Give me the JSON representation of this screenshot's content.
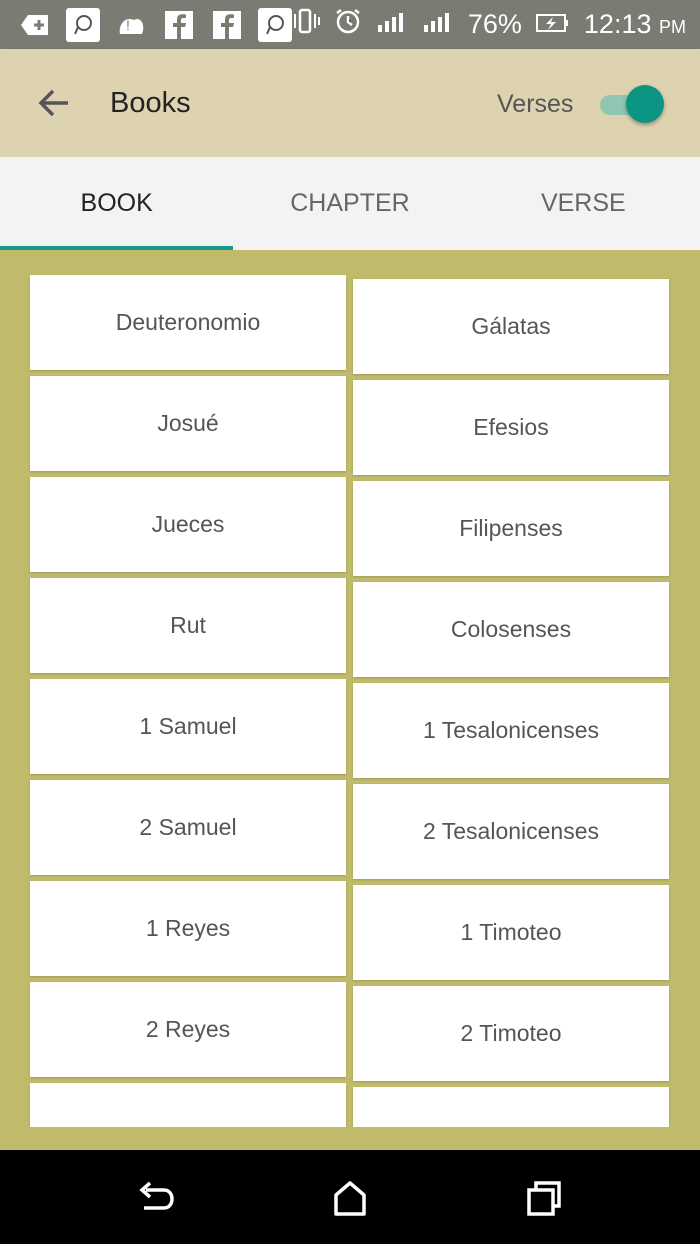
{
  "status_bar": {
    "left_icons": [
      "add-icon",
      "social-app-icon",
      "weather-alert-icon",
      "facebook-icon",
      "facebook-icon",
      "social-app-icon"
    ],
    "battery": "76%",
    "time": "12:13",
    "time_suffix": "PM"
  },
  "appbar": {
    "title": "Books",
    "verses_label": "Verses",
    "verses_on": true,
    "accent_color": "#0d9584",
    "background_color": "#ded3b0"
  },
  "tabs": [
    {
      "label": "BOOK",
      "active": true
    },
    {
      "label": "CHAPTER",
      "active": false
    },
    {
      "label": "VERSE",
      "active": false
    }
  ],
  "books_left": [
    "Deuteronomio",
    "Josué",
    "Jueces",
    "Rut",
    "1 Samuel",
    "2 Samuel",
    "1 Reyes",
    "2 Reyes"
  ],
  "books_right": [
    "Gálatas",
    "Efesios",
    "Filipenses",
    "Colosenses",
    "1 Tesalonicenses",
    "2 Tesalonicenses",
    "1 Timoteo",
    "2 Timoteo"
  ],
  "grid_background": "#c0bb6b",
  "navbar": {
    "buttons": [
      "back-nav-icon",
      "home-nav-icon",
      "recents-nav-icon"
    ]
  }
}
